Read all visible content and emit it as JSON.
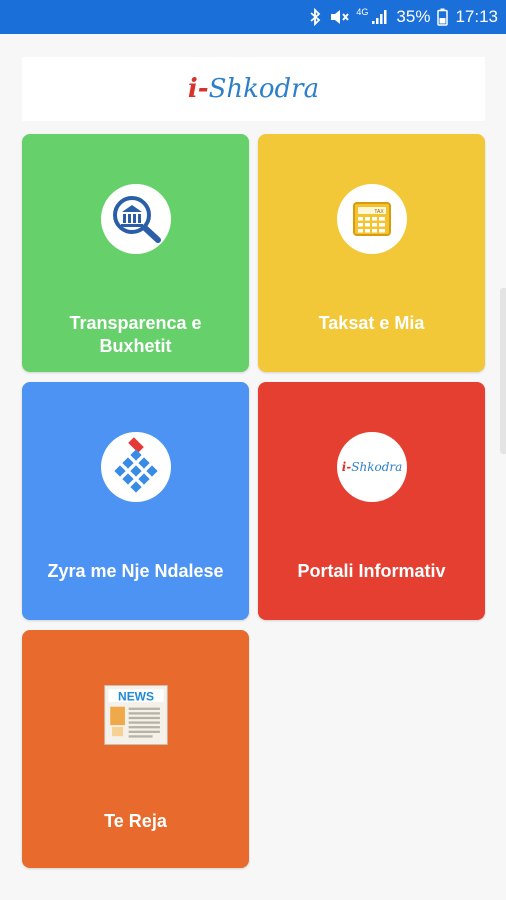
{
  "status_bar": {
    "network": "4G",
    "battery": "35%",
    "time": "17:13"
  },
  "header": {
    "logo_prefix": "i-",
    "logo_name": "Shkodra"
  },
  "tiles": [
    {
      "label": "Transparenca e Buxhetit",
      "icon": "bank-search-icon",
      "color": "#66d16b"
    },
    {
      "label": "Taksat e Mia",
      "icon": "calculator-icon",
      "color": "#f2c738"
    },
    {
      "label": "Zyra me Nje Ndalese",
      "icon": "office-grid-icon",
      "color": "#4c93f4"
    },
    {
      "label": "Portali Informativ",
      "icon": "i-shkodra-logo-icon",
      "color": "#e53f32"
    },
    {
      "label": "Te Reja",
      "icon": "news-icon",
      "color": "#e86b2d"
    }
  ],
  "icons": {
    "calculator_tag": "TAX",
    "news_tag": "NEWS",
    "portal_logo_prefix": "i-",
    "portal_logo_name": "Shkodra"
  }
}
